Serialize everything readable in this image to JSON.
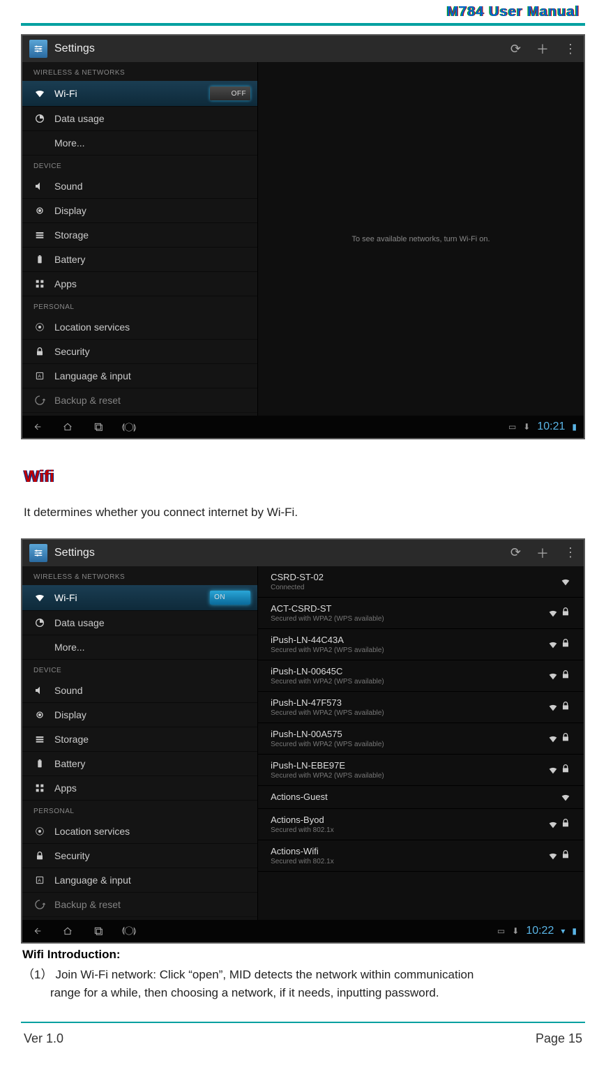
{
  "header_title": "M784  User  Manual",
  "footer": {
    "version": "Ver 1.0",
    "page": "Page 15"
  },
  "section_wifi_title": "Wifi",
  "wifi_para": "It determines whether you connect internet by Wi-Fi.",
  "wifi_intro_heading": "Wifi Introduction:",
  "wifi_intro_item_num": "（1）",
  "wifi_intro_item_text_line1": "Join Wi-Fi network: Click “open”, MID detects the network within communication",
  "wifi_intro_item_text_line2": "range for a while, then choosing a network, if it needs, inputting password.",
  "shot1": {
    "app_title": "Settings",
    "main_hint": "To see available networks, turn Wi-Fi on.",
    "wifi_toggle": "OFF",
    "time": "10:21",
    "sections": {
      "s1": "WIRELESS & NETWORKS",
      "s2": "DEVICE",
      "s3": "PERSONAL"
    },
    "items": {
      "wifi": "Wi-Fi",
      "data": "Data usage",
      "more": "More...",
      "sound": "Sound",
      "display": "Display",
      "storage": "Storage",
      "battery": "Battery",
      "apps": "Apps",
      "location": "Location services",
      "security": "Security",
      "lang": "Language & input",
      "backup": "Backup & reset"
    }
  },
  "shot2": {
    "app_title": "Settings",
    "wifi_toggle": "ON",
    "time": "10:22",
    "sections": {
      "s1": "WIRELESS & NETWORKS",
      "s2": "DEVICE",
      "s3": "PERSONAL"
    },
    "items": {
      "wifi": "Wi-Fi",
      "data": "Data usage",
      "more": "More...",
      "sound": "Sound",
      "display": "Display",
      "storage": "Storage",
      "battery": "Battery",
      "apps": "Apps",
      "location": "Location services",
      "security": "Security",
      "lang": "Language & input",
      "backup": "Backup & reset"
    },
    "networks": [
      {
        "ssid": "CSRD-ST-02",
        "sub": "Connected",
        "lock": false
      },
      {
        "ssid": "ACT-CSRD-ST",
        "sub": "Secured with WPA2 (WPS available)",
        "lock": true
      },
      {
        "ssid": "iPush-LN-44C43A",
        "sub": "Secured with WPA2 (WPS available)",
        "lock": true
      },
      {
        "ssid": "iPush-LN-00645C",
        "sub": "Secured with WPA2 (WPS available)",
        "lock": true
      },
      {
        "ssid": "iPush-LN-47F573",
        "sub": "Secured with WPA2 (WPS available)",
        "lock": true
      },
      {
        "ssid": "iPush-LN-00A575",
        "sub": "Secured with WPA2 (WPS available)",
        "lock": true
      },
      {
        "ssid": "iPush-LN-EBE97E",
        "sub": "Secured with WPA2 (WPS available)",
        "lock": true
      },
      {
        "ssid": "Actions-Guest",
        "sub": "",
        "lock": false
      },
      {
        "ssid": "Actions-Byod",
        "sub": "Secured with 802.1x",
        "lock": true
      },
      {
        "ssid": "Actions-Wifi",
        "sub": "Secured with 802.1x",
        "lock": true
      }
    ]
  }
}
